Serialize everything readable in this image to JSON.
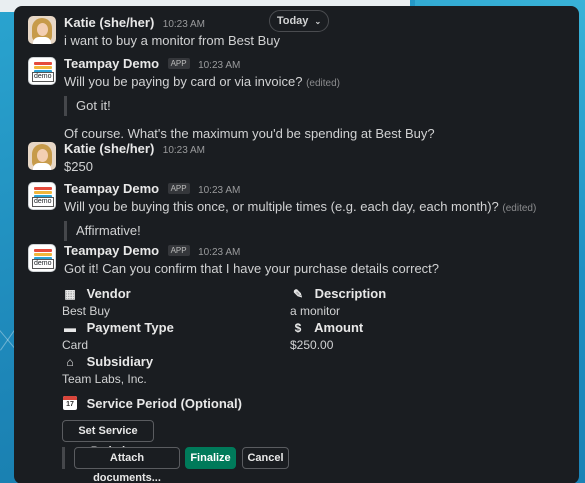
{
  "today_label": "Today",
  "messages": [
    {
      "sender": "Katie (she/her)",
      "time": "10:23 AM",
      "text": "i want to buy a monitor from Best Buy"
    },
    {
      "sender": "Teampay Demo",
      "badge": "APP",
      "time": "10:23 AM",
      "text": "Will you be paying by card or via invoice?",
      "edited": "(edited)",
      "quote": "Got it!",
      "followup": "Of course. What's the maximum you'd be spending at Best Buy?"
    },
    {
      "sender": "Katie (she/her)",
      "time": "10:23 AM",
      "text": "$250"
    },
    {
      "sender": "Teampay Demo",
      "badge": "APP",
      "time": "10:23 AM",
      "text": "Will you be buying this once, or multiple times (e.g. each day, each month)?",
      "edited": "(edited)",
      "quote": "Affirmative!"
    },
    {
      "sender": "Teampay Demo",
      "badge": "APP",
      "time": "10:23 AM",
      "text": "Got it! Can you confirm that I have your purchase details correct?"
    }
  ],
  "avatar_tag": "demo",
  "fields": {
    "vendor": {
      "label": "Vendor",
      "value": "Best Buy",
      "icon": "office-building-icon"
    },
    "description": {
      "label": "Description",
      "value": "a monitor",
      "icon": "memo-icon"
    },
    "payment_type": {
      "label": "Payment Type",
      "value": "Card",
      "icon": "credit-card-icon"
    },
    "amount": {
      "label": "Amount",
      "value": "$250.00",
      "icon": "money-bag-icon"
    },
    "subsidiary": {
      "label": "Subsidiary",
      "value": "Team Labs, Inc.",
      "icon": "classical-building-icon"
    },
    "service_period": {
      "label": "Service Period (Optional)",
      "icon": "calendar-icon",
      "calendar_day": "17"
    }
  },
  "buttons": {
    "set_service_period": "Set Service Period",
    "attach_documents": "Attach documents...",
    "finalize": "Finalize",
    "cancel": "Cancel"
  },
  "colors": {
    "panel_bg": "#1a1d21",
    "primary_button": "#007a5a",
    "background": "#1f8fbf"
  }
}
